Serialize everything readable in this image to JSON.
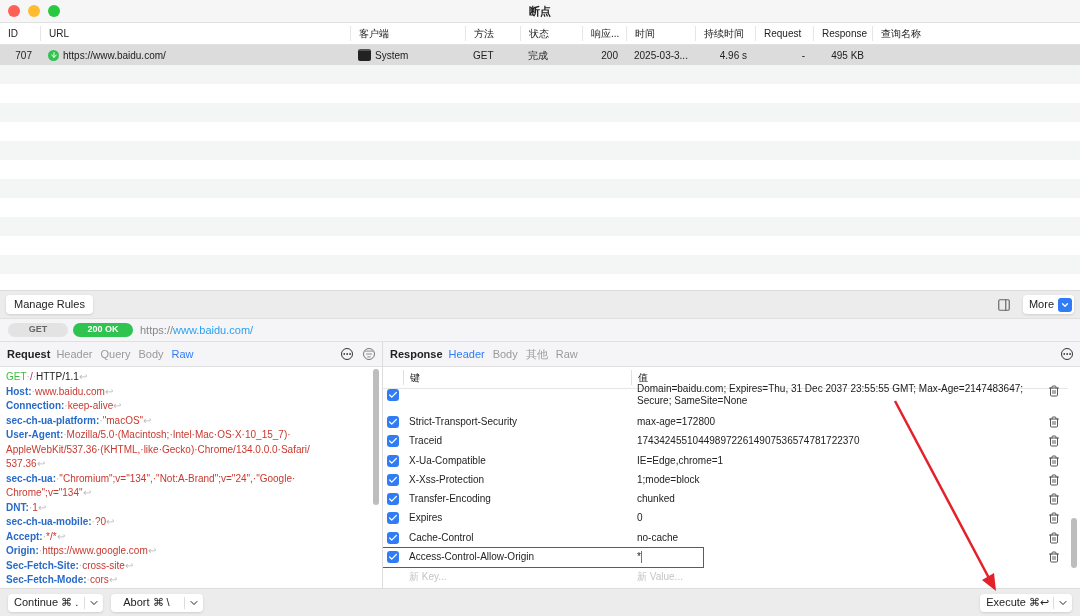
{
  "window": {
    "title": "断点"
  },
  "table": {
    "columns": [
      "ID",
      "URL",
      "客户端",
      "方法",
      "状态",
      "响应...",
      "时间",
      "持续时间",
      "Request",
      "Response",
      "查询名称"
    ],
    "rows": [
      {
        "selected": true,
        "cells": [
          "707",
          "https://www.baidu.com/",
          "System",
          "GET",
          "完成",
          "200",
          "2025-03-3...",
          "4.96 s",
          "-",
          "495 KB"
        ]
      }
    ]
  },
  "toolbar": {
    "manage_rules": "Manage Rules",
    "more": "More"
  },
  "url_bar": {
    "method": "GET",
    "status": "200 OK",
    "url_prefix": "https://",
    "url_host": "www.baidu.com/"
  },
  "request": {
    "title": "Request",
    "tabs": [
      {
        "label": "Header",
        "selected": false
      },
      {
        "label": "Query",
        "selected": false
      },
      {
        "label": "Body",
        "selected": false
      },
      {
        "label": "Raw",
        "selected": true
      }
    ],
    "lines": [
      [
        {
          "kind": "method",
          "text": "GET"
        },
        {
          "kind": "sep",
          "text": "·"
        },
        {
          "kind": "path",
          "text": "/"
        },
        {
          "kind": "sep",
          "text": "·"
        },
        {
          "kind": "plain",
          "text": "HTTP/1.1"
        },
        {
          "kind": "eol",
          "text": "↩"
        }
      ],
      [
        {
          "kind": "key",
          "text": "Host:"
        },
        {
          "kind": "sep",
          "text": "·"
        },
        {
          "kind": "value",
          "text": "www.baidu.com"
        },
        {
          "kind": "eol",
          "text": "↩"
        }
      ],
      [
        {
          "kind": "key",
          "text": "Connection:"
        },
        {
          "kind": "sep",
          "text": "·"
        },
        {
          "kind": "value",
          "text": "keep-alive"
        },
        {
          "kind": "eol",
          "text": "↩"
        }
      ],
      [
        {
          "kind": "key",
          "text": "sec-ch-ua-platform:"
        },
        {
          "kind": "sep",
          "text": "·"
        },
        {
          "kind": "value",
          "text": "\"macOS\""
        },
        {
          "kind": "eol",
          "text": "↩"
        }
      ],
      [
        {
          "kind": "key",
          "text": "User-Agent:"
        },
        {
          "kind": "sep",
          "text": "·"
        },
        {
          "kind": "value",
          "text": "Mozilla/5.0·(Macintosh;·Intel·Mac·OS·X·10_15_7)·"
        }
      ],
      [
        {
          "kind": "value",
          "text": "AppleWebKit/537.36·(KHTML,·like·Gecko)·Chrome/134.0.0.0·Safari/"
        }
      ],
      [
        {
          "kind": "value",
          "text": "537.36"
        },
        {
          "kind": "eol",
          "text": "↩"
        }
      ],
      [
        {
          "kind": "key",
          "text": "sec-ch-ua:"
        },
        {
          "kind": "sep",
          "text": "·"
        },
        {
          "kind": "value",
          "text": "\"Chromium\";v=\"134\",·\"Not:A-Brand\";v=\"24\",·\"Google·"
        }
      ],
      [
        {
          "kind": "value",
          "text": "Chrome\";v=\"134\""
        },
        {
          "kind": "eol",
          "text": "↩"
        }
      ],
      [
        {
          "kind": "key",
          "text": "DNT:"
        },
        {
          "kind": "sep",
          "text": "·"
        },
        {
          "kind": "value",
          "text": "1"
        },
        {
          "kind": "eol",
          "text": "↩"
        }
      ],
      [
        {
          "kind": "key",
          "text": "sec-ch-ua-mobile:"
        },
        {
          "kind": "sep",
          "text": "·"
        },
        {
          "kind": "value",
          "text": "?0"
        },
        {
          "kind": "eol",
          "text": "↩"
        }
      ],
      [
        {
          "kind": "key",
          "text": "Accept:"
        },
        {
          "kind": "sep",
          "text": "·"
        },
        {
          "kind": "value",
          "text": "*/*"
        },
        {
          "kind": "eol",
          "text": "↩"
        }
      ],
      [
        {
          "kind": "key",
          "text": "Origin:"
        },
        {
          "kind": "sep",
          "text": "·"
        },
        {
          "kind": "value",
          "text": "https://www.google.com"
        },
        {
          "kind": "eol",
          "text": "↩"
        }
      ],
      [
        {
          "kind": "key",
          "text": "Sec-Fetch-Site:"
        },
        {
          "kind": "sep",
          "text": "·"
        },
        {
          "kind": "value",
          "text": "cross-site"
        },
        {
          "kind": "eol",
          "text": "↩"
        }
      ],
      [
        {
          "kind": "key",
          "text": "Sec-Fetch-Mode:"
        },
        {
          "kind": "sep",
          "text": "·"
        },
        {
          "kind": "value",
          "text": "cors"
        },
        {
          "kind": "eol",
          "text": "↩"
        }
      ]
    ]
  },
  "response": {
    "title": "Response",
    "tabs": [
      {
        "label": "Header",
        "selected": true
      },
      {
        "label": "Body",
        "selected": false
      },
      {
        "label": "其他",
        "selected": false
      },
      {
        "label": "Raw",
        "selected": false
      }
    ],
    "columns": [
      "键",
      "值"
    ],
    "rows": [
      {
        "checked": true,
        "highlighted": false,
        "value_lines": [
          "Domain=baidu.com; Expires=Thu, 31 Dec 2037 23:55:55 GMT; Max-Age=2147483647;",
          "Secure; SameSite=None"
        ]
      },
      {
        "checked": true,
        "highlighted": false,
        "key": "Strict-Transport-Security",
        "value_lines": [
          "max-age=172800"
        ]
      },
      {
        "checked": true,
        "highlighted": false,
        "key": "Traceid",
        "value_lines": [
          "1743424551044989722614907536574781722370"
        ]
      },
      {
        "checked": true,
        "highlighted": false,
        "key": "X-Ua-Compatible",
        "value_lines": [
          "IE=Edge,chrome=1"
        ]
      },
      {
        "checked": true,
        "highlighted": false,
        "key": "X-Xss-Protection",
        "value_lines": [
          "1;mode=block"
        ]
      },
      {
        "checked": true,
        "highlighted": false,
        "key": "Transfer-Encoding",
        "value_lines": [
          "chunked"
        ]
      },
      {
        "checked": true,
        "highlighted": false,
        "key": "Expires",
        "value_lines": [
          "0"
        ]
      },
      {
        "checked": true,
        "highlighted": false,
        "key": "Cache-Control",
        "value_lines": [
          "no-cache"
        ]
      },
      {
        "checked": true,
        "highlighted": true,
        "key": "Access-Control-Allow-Origin",
        "value_lines": [
          "*"
        ]
      }
    ],
    "new_row": {
      "key_placeholder": "新 Key...",
      "value_placeholder": "新 Value..."
    }
  },
  "footer": {
    "continue": "Continue ⌘ .",
    "abort": "Abort ⌘ \\",
    "execute": "Execute ⌘↩"
  }
}
